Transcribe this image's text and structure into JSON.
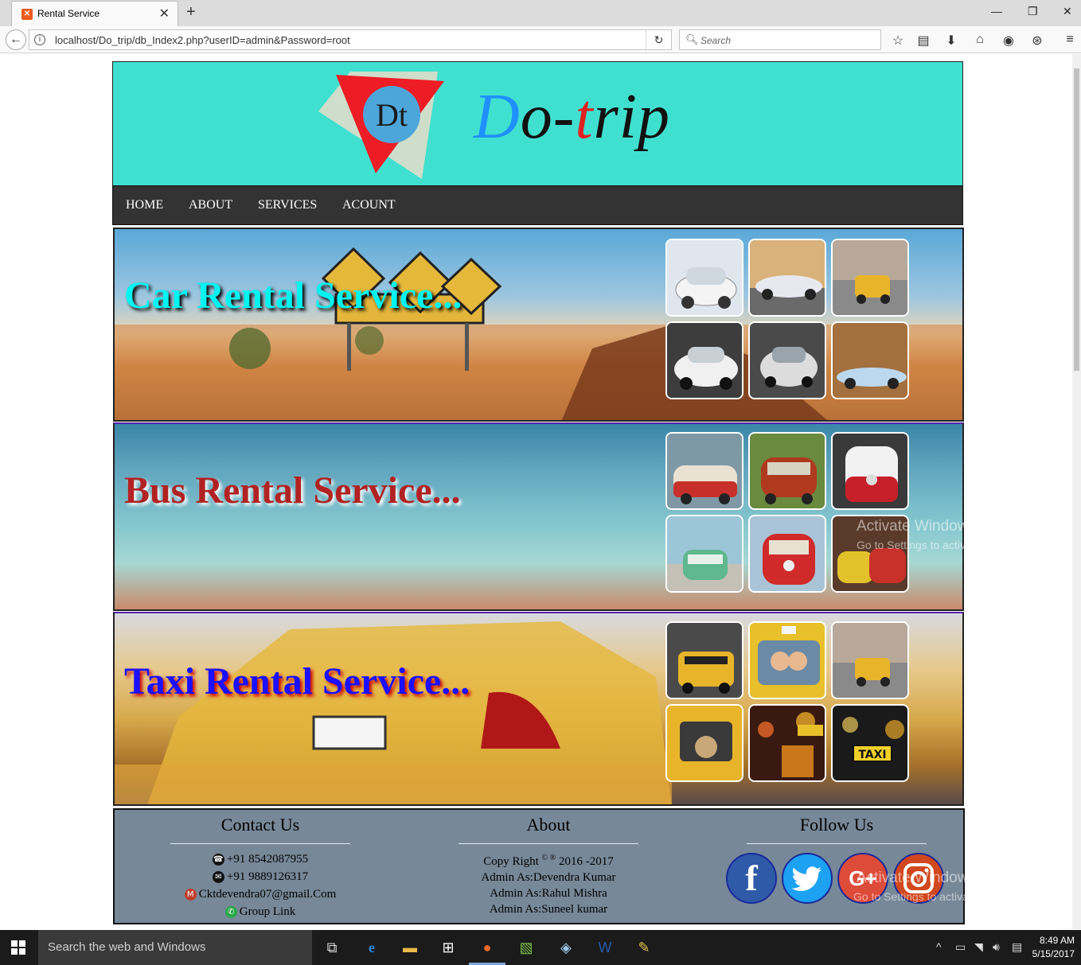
{
  "browser": {
    "tab_title": "Rental Service",
    "url": "localhost/Do_trip/db_Index2.php?userID=admin&Password=root",
    "search_placeholder": "Search"
  },
  "site": {
    "brand_parts": [
      "D",
      "o-",
      "t",
      "rip"
    ],
    "logo_letters": "Dt",
    "menu": [
      "HOME",
      "ABOUT",
      "SERVICES",
      "ACOUNT"
    ],
    "services": [
      {
        "title": "Car Rental Service...",
        "title_color": "#00f5f0"
      },
      {
        "title": "Bus Rental Service...",
        "title_color": "#b22222"
      },
      {
        "title": "Taxi Rental Service...",
        "title_color": "#1a10ff"
      }
    ],
    "footer": {
      "contact": {
        "heading": "Contact Us",
        "phone1": "+91 8542087955",
        "phone2": "+91 9889126317",
        "email": "Cktdevendra07@gmail.Com",
        "group": "Group Link"
      },
      "about": {
        "heading": "About",
        "copyright_prefix": "Copy Right",
        "copyright_marks": "© ®",
        "copyright_years": "2016 -2017",
        "admins": [
          "Admin As:Devendra Kumar",
          "Admin As:Rahul Mishra",
          "Admin As:Suneel kumar"
        ]
      },
      "follow": {
        "heading": "Follow Us",
        "networks": [
          {
            "name": "facebook",
            "glyph": "f",
            "color": "#2f5aa8"
          },
          {
            "name": "twitter",
            "glyph": "🐦",
            "color": "#1da1f2"
          },
          {
            "name": "google-plus",
            "glyph": "G+",
            "color": "#dd4b39"
          },
          {
            "name": "instagram",
            "glyph": "◎",
            "color": "#d2481e"
          }
        ]
      }
    }
  },
  "watermark": {
    "line1": "Activate Windows",
    "line2": "Go to Settings to activate Windows."
  },
  "taskbar": {
    "search_text": "Search the web and Windows",
    "time": "8:49 AM",
    "date": "5/15/2017"
  }
}
